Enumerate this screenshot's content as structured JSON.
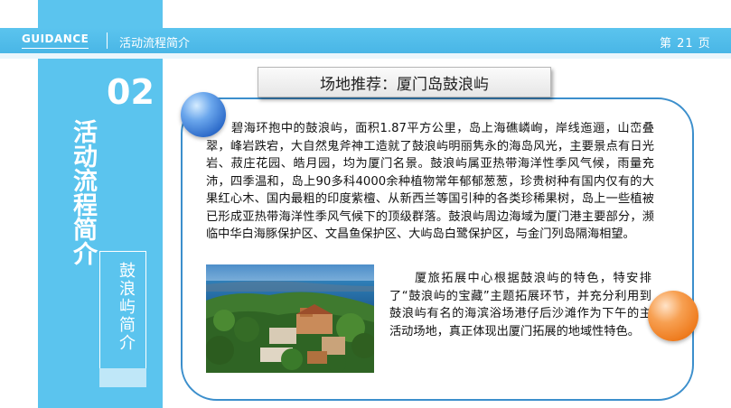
{
  "header": {
    "guidance": "GUIDANCE",
    "section_title": "活动流程简介",
    "page_number": "第 21 页"
  },
  "side": {
    "section_number": "02",
    "vertical_title": "活动流程简介",
    "vertical_subtitle": "鼓浪屿简介"
  },
  "main": {
    "title": "场地推荐：厦门岛鼓浪屿",
    "paragraph1": "碧海环抱中的鼓浪屿，面积1.87平方公里，岛上海礁嶙峋，岸线迤逦，山峦叠翠，峰岩跌宕，大自然鬼斧神工造就了鼓浪屿明丽隽永的海岛风光，主要景点有日光岩、菽庄花园、皓月园，均为厦门名景。鼓浪屿属亚热带海洋性季风气候，雨量充沛，四季温和，岛上90多科4000余种植物常年郁郁葱葱，珍贵树种有国内仅有的大果红心木、国内最粗的印度紫檀、从新西兰等国引种的各类珍稀果树，岛上一些植被已形成亚热带海洋性季风气候下的顶级群落。鼓浪屿周边海域为厦门港主要部分，濒临中华白海豚保护区、文昌鱼保护区、大屿岛白鹭保护区，与金门列岛隔海相望。",
    "paragraph2": "厦旅拓展中心根据鼓浪屿的特色，特安排了“鼓浪屿的宝藏”主题拓展环节，并充分利用到鼓浪屿有名的海滨浴场港仔后沙滩作为下午的主活动场地，真正体现出厦门拓展的地域性特色。"
  },
  "colors": {
    "accent_blue": "#5bc4ee",
    "frame_blue": "#3c8fcc",
    "ball_blue": "#2d6bc9",
    "ball_orange": "#ee7a1c"
  }
}
